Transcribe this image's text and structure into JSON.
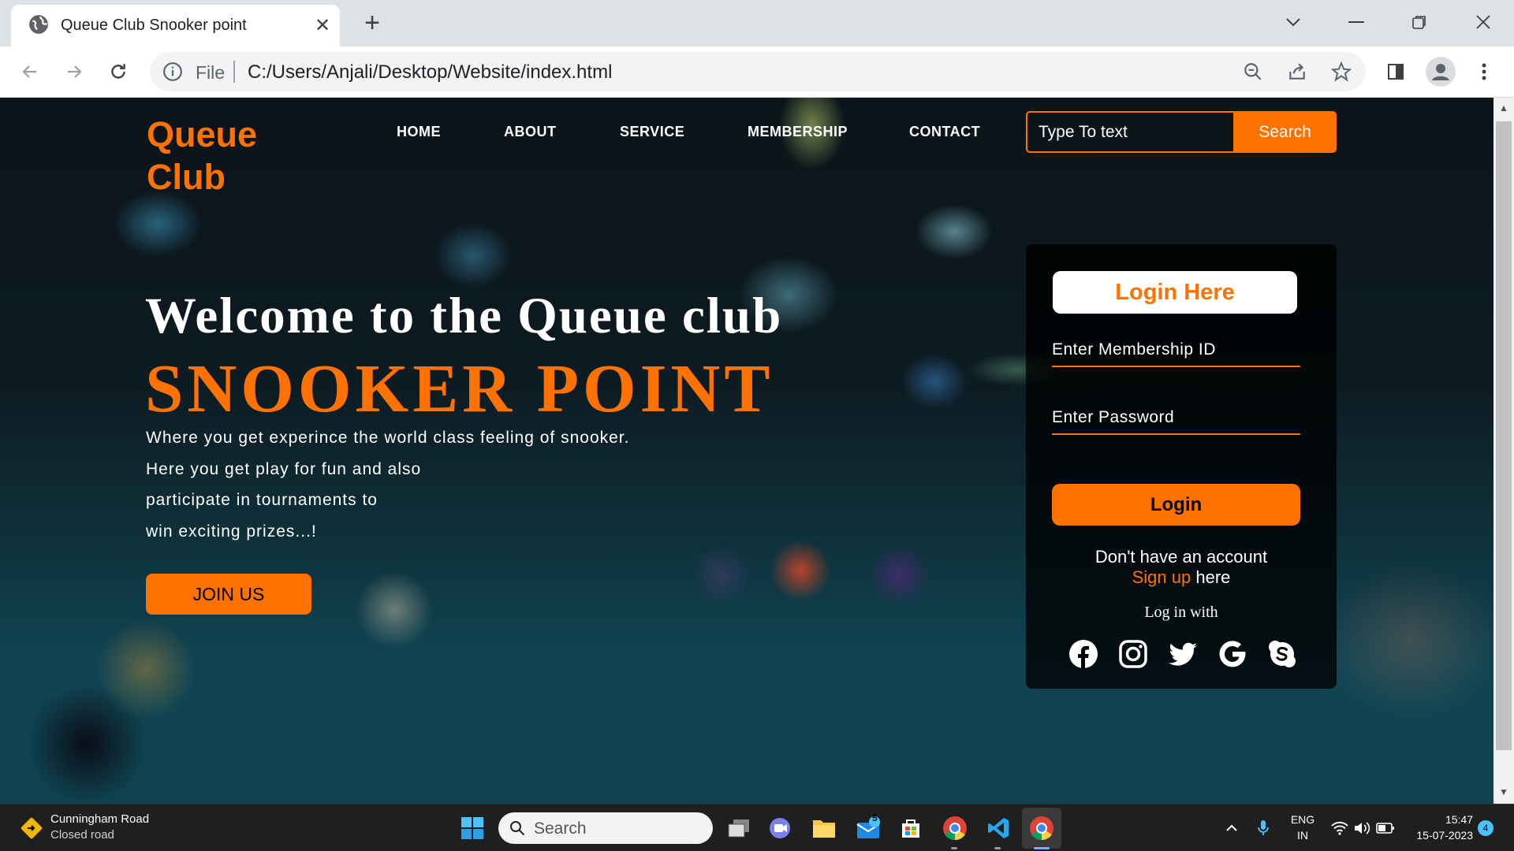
{
  "browser": {
    "tab_title": "Queue Club Snooker point",
    "address_scheme": "File",
    "address_url": "C:/Users/Anjali/Desktop/Website/index.html"
  },
  "site": {
    "logo_line1": "Queue",
    "logo_line2": "Club",
    "nav": [
      "HOME",
      "ABOUT",
      "SERVICE",
      "MEMBERSHIP",
      "CONTACT"
    ],
    "search_placeholder": "Type To text",
    "search_button": "Search",
    "hero": {
      "title": "Welcome to the Queue club",
      "subtitle": "SNOOKER POINT",
      "description": [
        "Where you get experince the world class feeling of snooker.",
        "Here you get play for fun and also",
        "participate in tournaments to",
        "win exciting prizes...!"
      ],
      "join_button": "JOIN US"
    },
    "login": {
      "title": "Login Here",
      "membership_placeholder": "Enter Membership ID",
      "password_placeholder": "Enter Password",
      "login_button": "Login",
      "no_account": "Don't have an account",
      "signup_link": "Sign up",
      "signup_suffix": " here",
      "login_with": "Log in with",
      "social_icons": [
        "facebook-icon",
        "instagram-icon",
        "twitter-icon",
        "google-icon",
        "skype-icon"
      ]
    },
    "colors": {
      "accent": "#ff7200"
    }
  },
  "taskbar": {
    "weather_title": "Cunningham Road",
    "weather_subtitle": "Closed road",
    "search_label": "Search",
    "mail_badge": "5",
    "lang_line1": "ENG",
    "lang_line2": "IN",
    "time": "15:47",
    "date": "15-07-2023",
    "notification_count": "4"
  }
}
